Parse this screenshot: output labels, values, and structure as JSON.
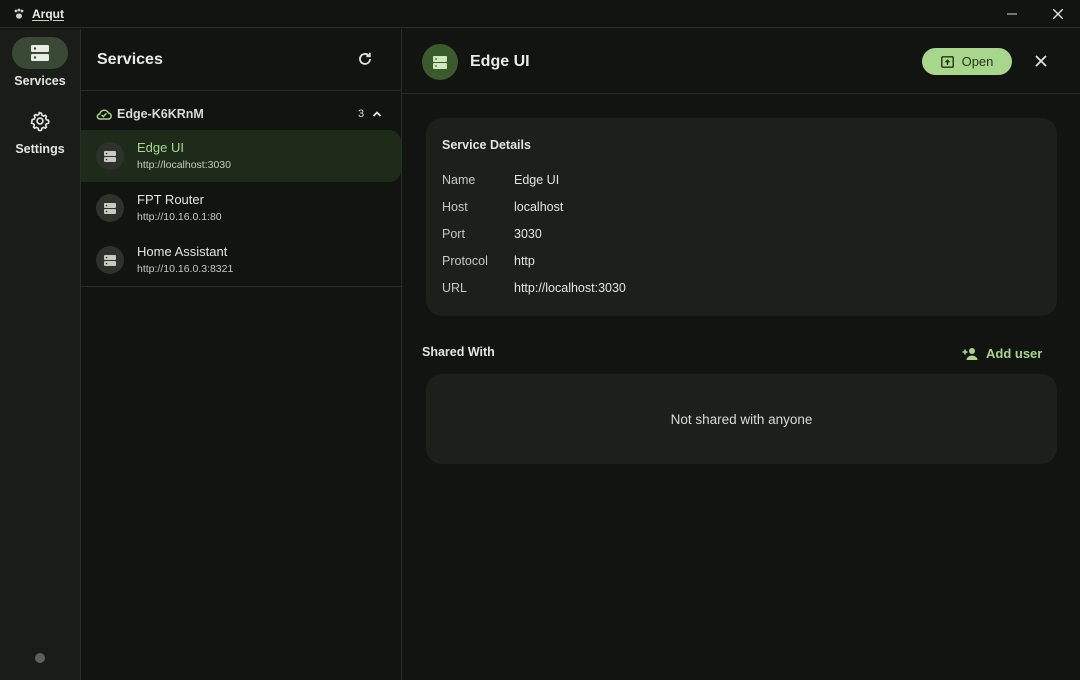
{
  "app": {
    "title": "Arqut",
    "icon": "paw-icon"
  },
  "window_controls": {
    "minimize_icon": "minimize-icon",
    "close_icon": "close-icon"
  },
  "nav": {
    "items": [
      {
        "label": "Services",
        "icon": "server-icon",
        "active": true
      },
      {
        "label": "Settings",
        "icon": "gear-icon",
        "active": false
      }
    ]
  },
  "services_panel": {
    "title": "Services",
    "refresh_icon": "refresh-icon",
    "group": {
      "name": "Edge-K6KRnM",
      "count": "3",
      "icon": "cloud-check-icon",
      "expanded": true
    },
    "services": [
      {
        "name": "Edge UI",
        "url": "http://localhost:3030",
        "active": true
      },
      {
        "name": "FPT Router",
        "url": "http://10.16.0.1:80",
        "active": false
      },
      {
        "name": "Home Assistant",
        "url": "http://10.16.0.3:8321",
        "active": false
      }
    ]
  },
  "detail": {
    "title": "Edge UI",
    "open_label": "Open",
    "service_details": {
      "title": "Service Details",
      "rows": [
        {
          "key": "Name",
          "value": "Edge UI"
        },
        {
          "key": "Host",
          "value": "localhost"
        },
        {
          "key": "Port",
          "value": "3030"
        },
        {
          "key": "Protocol",
          "value": "http"
        },
        {
          "key": "URL",
          "value": "http://localhost:3030"
        }
      ]
    },
    "shared": {
      "title": "Shared With",
      "add_label": "Add user",
      "empty_message": "Not shared with anyone"
    }
  },
  "colors": {
    "background": "#121411",
    "rail": "#1a1c18",
    "accent": "#a8d68c",
    "selected_row": "#1e2b1b",
    "card": "#1c1f1a"
  }
}
